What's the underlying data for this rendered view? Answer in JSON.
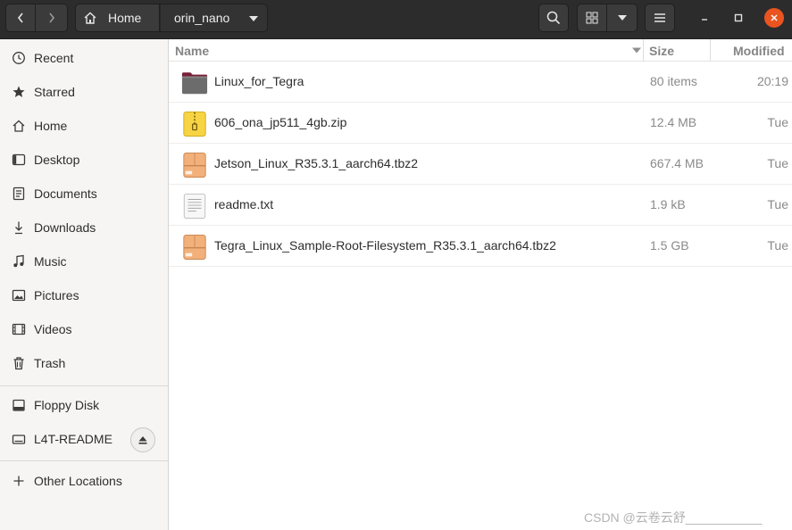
{
  "header": {
    "breadcrumb_home": "Home",
    "breadcrumb_current": "orin_nano"
  },
  "sidebar": {
    "places": [
      {
        "label": "Recent",
        "icon": "clock-icon"
      },
      {
        "label": "Starred",
        "icon": "star-icon"
      },
      {
        "label": "Home",
        "icon": "home-icon"
      },
      {
        "label": "Desktop",
        "icon": "desktop-icon"
      },
      {
        "label": "Documents",
        "icon": "documents-icon"
      },
      {
        "label": "Downloads",
        "icon": "download-icon"
      },
      {
        "label": "Music",
        "icon": "music-icon"
      },
      {
        "label": "Pictures",
        "icon": "pictures-icon"
      },
      {
        "label": "Videos",
        "icon": "videos-icon"
      },
      {
        "label": "Trash",
        "icon": "trash-icon"
      }
    ],
    "devices": [
      {
        "label": "Floppy Disk",
        "icon": "drive-icon"
      },
      {
        "label": "L4T-README",
        "icon": "removable-drive-icon"
      }
    ],
    "other": {
      "label": "Other Locations",
      "icon": "plus-icon"
    }
  },
  "columns": {
    "name": "Name",
    "size": "Size",
    "modified": "Modified"
  },
  "files": [
    {
      "name": "Linux_for_Tegra",
      "size": "80 items",
      "modified": "20:19",
      "icon": "folder-icon"
    },
    {
      "name": "606_ona_jp511_4gb.zip",
      "size": "12.4 MB",
      "modified": "Tue",
      "icon": "zip-archive-icon"
    },
    {
      "name": "Jetson_Linux_R35.3.1_aarch64.tbz2",
      "size": "667.4 MB",
      "modified": "Tue",
      "icon": "tar-archive-icon"
    },
    {
      "name": "readme.txt",
      "size": "1.9 kB",
      "modified": "Tue",
      "icon": "text-file-icon"
    },
    {
      "name": "Tegra_Linux_Sample-Root-Filesystem_R35.3.1_aarch64.tbz2",
      "size": "1.5 GB",
      "modified": "Tue",
      "icon": "tar-archive-icon"
    }
  ],
  "watermark": "CSDN @云卷云舒___________",
  "colors": {
    "headerbar": "#2c2c2c",
    "close_button": "#e95420",
    "sidebar_bg": "#f6f5f4"
  }
}
